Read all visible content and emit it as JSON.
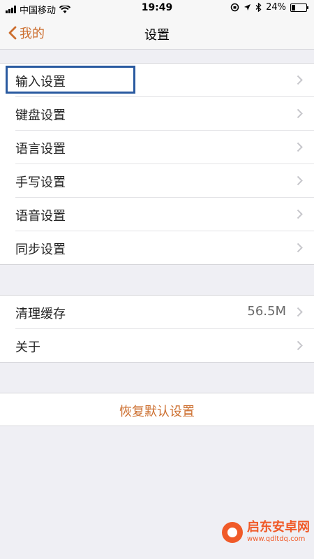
{
  "status_bar": {
    "carrier": "中国移动",
    "time": "19:49",
    "battery": "24%",
    "battery_level": 0.24
  },
  "nav": {
    "back_label": "我的",
    "title": "设置"
  },
  "settings_group_1": {
    "items": [
      {
        "label": "输入设置"
      },
      {
        "label": "键盘设置"
      },
      {
        "label": "语言设置"
      },
      {
        "label": "手写设置"
      },
      {
        "label": "语音设置"
      },
      {
        "label": "同步设置"
      }
    ]
  },
  "settings_group_2": {
    "items": [
      {
        "label": "清理缓存",
        "value": "56.5M"
      },
      {
        "label": "关于"
      }
    ]
  },
  "reset_label": "恢复默认设置",
  "watermark": {
    "title": "启东安卓网",
    "url": "www.qdltdq.com"
  },
  "colors": {
    "accent": "#cc6e2e",
    "background": "#efeff4",
    "highlight_border": "#2a5aa0"
  }
}
